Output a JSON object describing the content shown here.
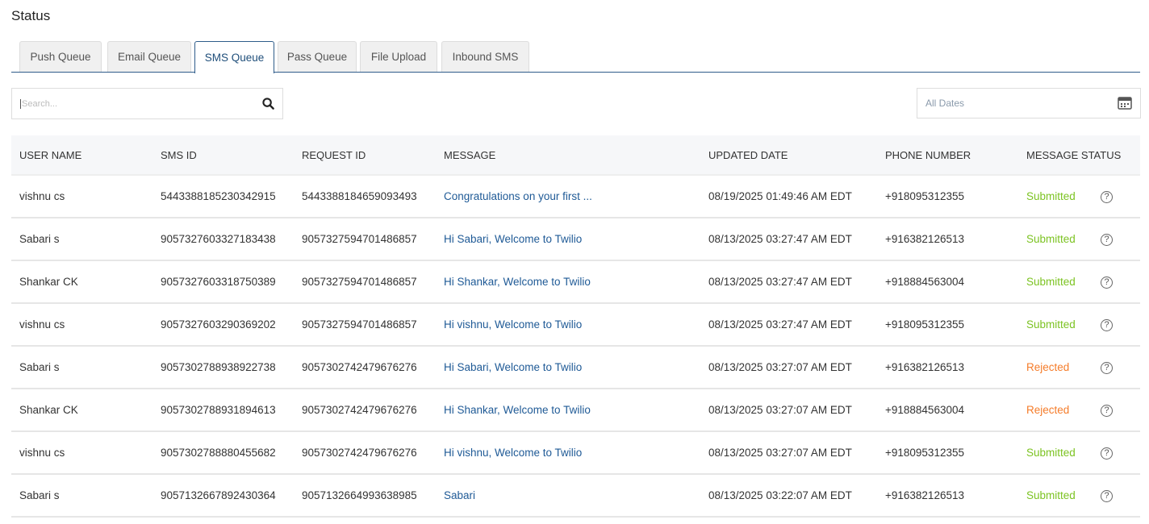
{
  "page_title": "Status",
  "tabs": [
    {
      "label": "Push Queue"
    },
    {
      "label": "Email Queue"
    },
    {
      "label": "SMS Queue",
      "active": true
    },
    {
      "label": "Pass Queue"
    },
    {
      "label": "File Upload"
    },
    {
      "label": "Inbound SMS"
    }
  ],
  "search": {
    "placeholder": "Search...",
    "value": ""
  },
  "date_filter": {
    "value": "All Dates"
  },
  "table": {
    "columns": [
      "USER NAME",
      "SMS ID",
      "REQUEST ID",
      "MESSAGE",
      "UPDATED DATE",
      "PHONE NUMBER",
      "MESSAGE STATUS"
    ],
    "rows": [
      [
        "vishnu cs",
        "5443388185230342915",
        "5443388184659093493",
        "Congratulations on your first ...",
        "08/19/2025 01:49:46 AM EDT",
        "+918095312355",
        "Submitted"
      ],
      [
        "Sabari s",
        "9057327603327183438",
        "9057327594701486857",
        "Hi Sabari, Welcome to Twilio",
        "08/13/2025 03:27:47 AM EDT",
        "+916382126513",
        "Submitted"
      ],
      [
        "Shankar CK",
        "9057327603318750389",
        "9057327594701486857",
        "Hi Shankar, Welcome to Twilio",
        "08/13/2025 03:27:47 AM EDT",
        "+918884563004",
        "Submitted"
      ],
      [
        "vishnu cs",
        "9057327603290369202",
        "9057327594701486857",
        "Hi vishnu, Welcome to Twilio",
        "08/13/2025 03:27:47 AM EDT",
        "+918095312355",
        "Submitted"
      ],
      [
        "Sabari s",
        "9057302788938922738",
        "9057302742479676276",
        "Hi Sabari, Welcome to Twilio",
        "08/13/2025 03:27:07 AM EDT",
        "+916382126513",
        "Rejected"
      ],
      [
        "Shankar CK",
        "9057302788931894613",
        "9057302742479676276",
        "Hi Shankar, Welcome to Twilio",
        "08/13/2025 03:27:07 AM EDT",
        "+918884563004",
        "Rejected"
      ],
      [
        "vishnu cs",
        "9057302788880455682",
        "9057302742479676276",
        "Hi vishnu, Welcome to Twilio",
        "08/13/2025 03:27:07 AM EDT",
        "+918095312355",
        "Submitted"
      ],
      [
        "Sabari s",
        "9057132667892430364",
        "9057132664993638985",
        "Sabari",
        "08/13/2025 03:22:07 AM EDT",
        "+916382126513",
        "Submitted"
      ]
    ]
  },
  "colors": {
    "accent": "#2f5c8a",
    "submitted": "#7cc322",
    "rejected": "#f57c2a",
    "link": "#1f5a96"
  }
}
